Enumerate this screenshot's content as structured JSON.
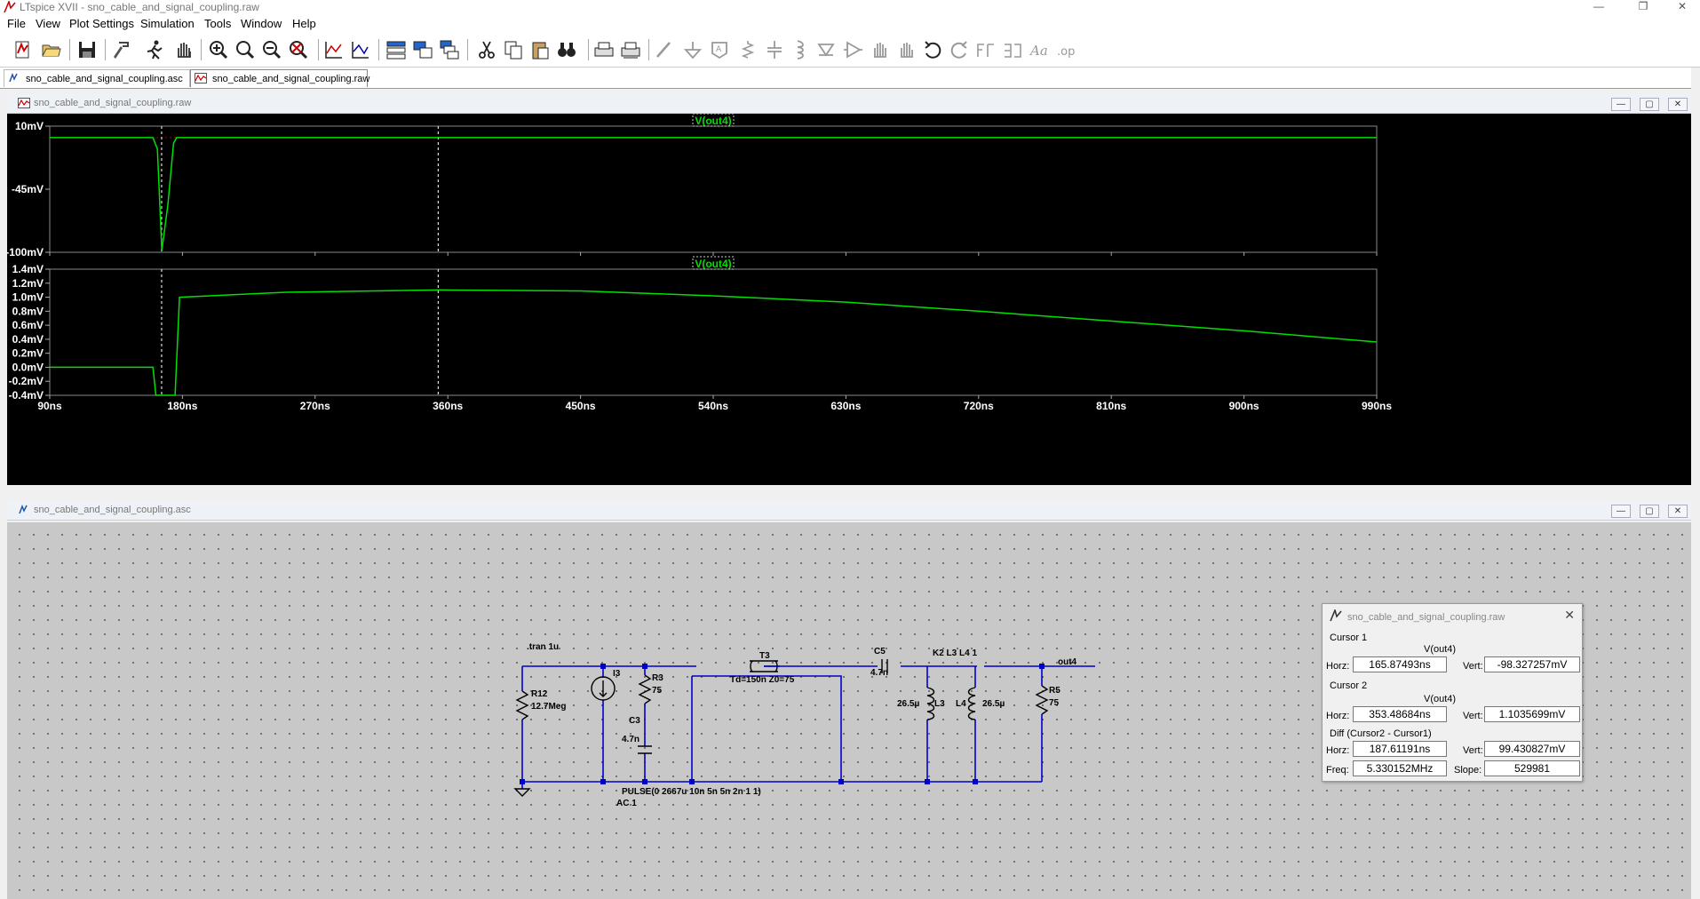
{
  "app": {
    "title": "LTspice XVII - sno_cable_and_signal_coupling.raw"
  },
  "menu": [
    "File",
    "View",
    "Plot Settings",
    "Simulation",
    "Tools",
    "Window",
    "Help"
  ],
  "tabs": [
    {
      "label": "sno_cable_and_signal_coupling.asc"
    },
    {
      "label": "sno_cable_and_signal_coupling.raw"
    }
  ],
  "plot_window": {
    "title": "sno_cable_and_signal_coupling.raw"
  },
  "schematic_window": {
    "title": "sno_cable_and_signal_coupling.asc"
  },
  "chart_data": [
    {
      "type": "line",
      "series": [
        {
          "name": "V(out4)",
          "color": "#00e000"
        }
      ],
      "x_ticks": [
        "90ns",
        "180ns",
        "270ns",
        "360ns",
        "450ns",
        "540ns",
        "630ns",
        "720ns",
        "810ns",
        "900ns",
        "990ns"
      ],
      "y_ticks": [
        "10mV",
        "-45mV",
        "-100mV"
      ],
      "xlim": [
        90,
        990
      ],
      "ylim": [
        -100,
        10
      ],
      "points": [
        [
          90,
          0
        ],
        [
          160,
          0
        ],
        [
          163,
          -10
        ],
        [
          166,
          -98.3
        ],
        [
          170,
          -60
        ],
        [
          174,
          -5
        ],
        [
          176,
          0
        ],
        [
          990,
          0
        ]
      ],
      "cursors_x": [
        165.87493,
        353.48684
      ]
    },
    {
      "type": "line",
      "series": [
        {
          "name": "V(out4)",
          "color": "#00e000"
        }
      ],
      "x_ticks": [
        "90ns",
        "180ns",
        "270ns",
        "360ns",
        "450ns",
        "540ns",
        "630ns",
        "720ns",
        "810ns",
        "900ns",
        "990ns"
      ],
      "y_ticks": [
        "1.4mV",
        "1.2mV",
        "1.0mV",
        "0.8mV",
        "0.6mV",
        "0.4mV",
        "0.2mV",
        "0.0mV",
        "-0.2mV",
        "-0.4mV"
      ],
      "xlim": [
        90,
        990
      ],
      "ylim": [
        -0.4,
        1.4
      ],
      "points": [
        [
          90,
          0
        ],
        [
          160,
          0
        ],
        [
          162,
          -0.4
        ],
        [
          175,
          -0.4
        ],
        [
          178,
          1.0
        ],
        [
          250,
          1.07
        ],
        [
          353.5,
          1.1036
        ],
        [
          450,
          1.09
        ],
        [
          540,
          1.02
        ],
        [
          630,
          0.93
        ],
        [
          720,
          0.8
        ],
        [
          810,
          0.66
        ],
        [
          900,
          0.52
        ],
        [
          990,
          0.36
        ]
      ],
      "cursors_x": [
        165.87493,
        353.48684
      ]
    }
  ],
  "schematic": {
    "directive": ".tran 1u",
    "labels": {
      "r12": "R12",
      "r12_val": "12.7Meg",
      "i3": "I3",
      "r3": "R3",
      "r3_val": "75",
      "c3": "C3",
      "c3_val": "4.7n",
      "t3": "T3",
      "t3_val": "Td=150n Z0=75",
      "c5": "C5",
      "c5_val": "4.7n",
      "k2": "K2 L3 L4 1",
      "l3": "L3",
      "l3_val": "26.5µ",
      "l4": "L4",
      "l4_val": "26.5µ",
      "r5": "R5",
      "r5_val": "75",
      "out4": "out4",
      "pulse": "PULSE(0 2667u 10n 5n 5n 2n 1 1)",
      "ac": "AC 1"
    }
  },
  "cursor_panel": {
    "title": "sno_cable_and_signal_coupling.raw",
    "cursor1": {
      "heading": "Cursor 1",
      "trace": "V(out4)",
      "horz_label": "Horz:",
      "horz": "165.87493ns",
      "vert_label": "Vert:",
      "vert": "-98.327257mV"
    },
    "cursor2": {
      "heading": "Cursor 2",
      "trace": "V(out4)",
      "horz_label": "Horz:",
      "horz": "353.48684ns",
      "vert_label": "Vert:",
      "vert": "1.1035699mV"
    },
    "diff": {
      "heading": "Diff (Cursor2 - Cursor1)",
      "horz_label": "Horz:",
      "horz": "187.61191ns",
      "vert_label": "Vert:",
      "vert": "99.430827mV",
      "freq_label": "Freq:",
      "freq": "5.330152MHz",
      "slope_label": "Slope:",
      "slope": "529981"
    }
  },
  "colors": {
    "trace": "#00e000",
    "wire": "#0000cc",
    "plot_bg": "#000000",
    "schematic_bg": "#c8c8c8"
  }
}
